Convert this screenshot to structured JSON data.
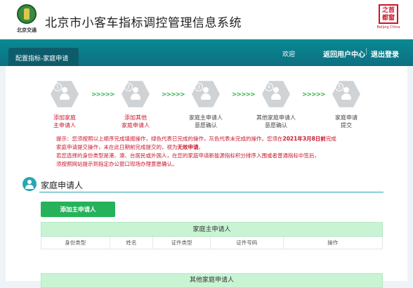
{
  "header": {
    "logo_text": "北京交通",
    "title": "北京市小客车指标调控管理信息系统",
    "seal_chars": "之首都窗",
    "seal_text": "Beijing China"
  },
  "nav": {
    "active_tab": "配置指标-家庭申请",
    "welcome": "欢迎",
    "user": "",
    "links": [
      "返回用户中心",
      "退出登录"
    ],
    "separator": "|"
  },
  "steps": [
    {
      "num": "1",
      "label": [
        "添加家庭",
        "主申请人"
      ],
      "color": "#c8162c"
    },
    {
      "num": "2",
      "label": [
        "添加其他",
        "家庭申请人"
      ],
      "color": "#c8162c"
    },
    {
      "num": "3",
      "label": [
        "家庭主申请人",
        "意愿确认"
      ],
      "color": "#444444"
    },
    {
      "num": "4",
      "label": [
        "其他家庭申请人",
        "意愿确认"
      ],
      "color": "#444444"
    },
    {
      "num": "5",
      "label": [
        "家庭申请",
        "提交"
      ],
      "color": "#444444"
    }
  ],
  "arrow_text": ">>>>>",
  "notice": {
    "line1_a": "提示：您须按照以上顺序完成填报操作，绿色代表已完成的操作，灰色代表未完成的操作。您须在",
    "line1_date": "2021年3月8日前",
    "line1_b": "完成",
    "line2_a": "家庭申请提交操作，未在此日期前完成提交的，视为",
    "line2_b": "无效申请",
    "line2_c": "。",
    "line3": "若您选择的身份类型是港、澳、台居民或外国人，在您的家庭申请新能源指标积分排序入围或者普通指标中签后，",
    "line4": "须按照网站提示到指定办公窗口现场办理意愿确认。"
  },
  "section": {
    "title": "家庭申请人"
  },
  "add_button": "添加主申请人",
  "main_table": {
    "title": "家庭主申请人",
    "columns": [
      "身份类型",
      "姓名",
      "证件类型",
      "证件号码",
      "操作"
    ]
  },
  "other_table": {
    "title": "其他家庭申请人"
  },
  "colors": {
    "nav_bg": "#0c6f82",
    "accent": "#2aa6b5",
    "green_button": "#25b25a",
    "table_header": "#c9f4d4",
    "warning_red": "#c8162c"
  }
}
